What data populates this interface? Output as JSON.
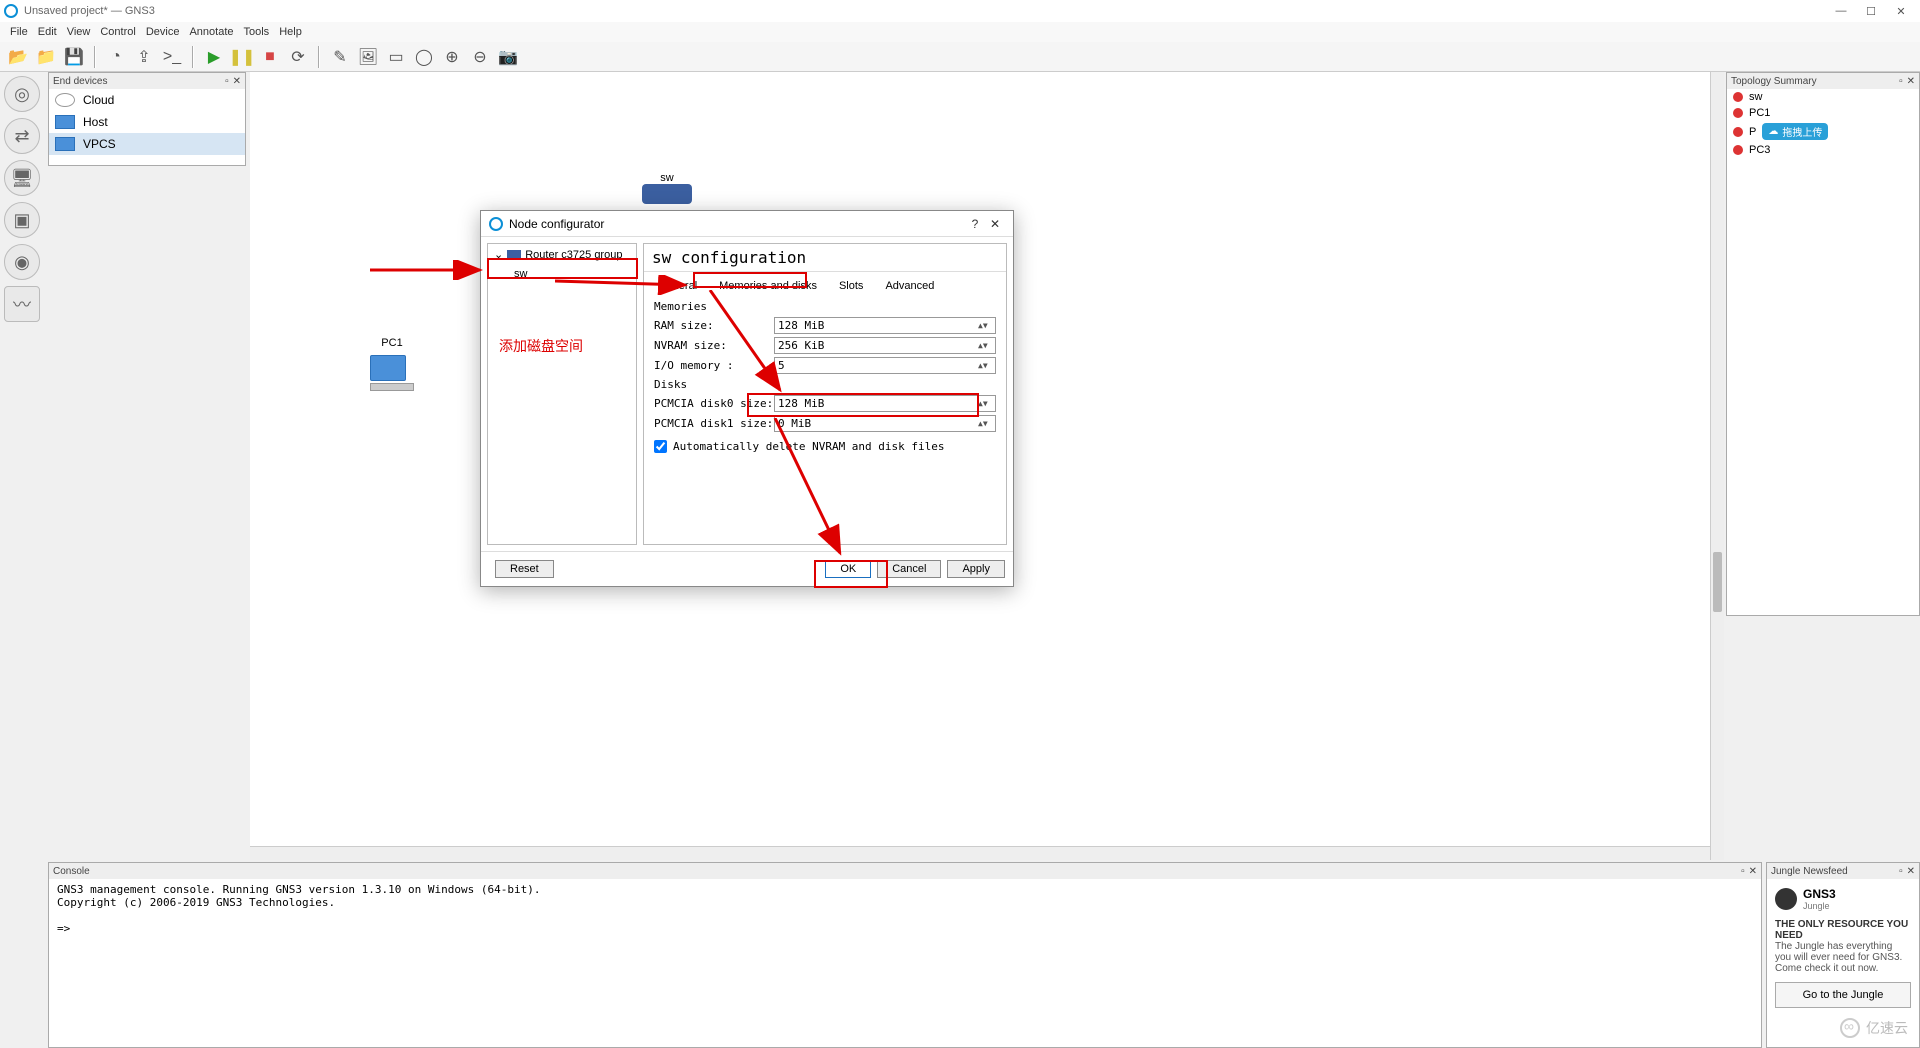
{
  "window": {
    "title": "Unsaved project* — GNS3",
    "controls": {
      "min": "—",
      "max": "☐",
      "close": "✕"
    }
  },
  "menubar": [
    "File",
    "Edit",
    "View",
    "Control",
    "Device",
    "Annotate",
    "Tools",
    "Help"
  ],
  "toolbar_icons": [
    "open-project",
    "open-folder",
    "save",
    "clock",
    "export",
    "console",
    "play",
    "pause",
    "stop",
    "reload",
    "edit-note",
    "image",
    "select-rect",
    "select-ellipse",
    "zoom-in",
    "zoom-out",
    "screenshot"
  ],
  "leftdock": [
    "router-category",
    "switch-category",
    "end-devices-category",
    "security-category",
    "all-devices-category",
    "link-tool"
  ],
  "panels": {
    "end_devices": {
      "title": "End devices",
      "items": [
        "Cloud",
        "Host",
        "VPCS"
      ],
      "selected": 2
    },
    "topology": {
      "title": "Topology Summary",
      "items": [
        "sw",
        "PC1",
        "PC2",
        "PC3"
      ],
      "upload_tag": "拖拽上传"
    },
    "console": {
      "title": "Console",
      "lines": [
        "GNS3 management console. Running GNS3 version 1.3.10 on Windows (64-bit).",
        "Copyright (c) 2006-2019 GNS3 Technologies.",
        "",
        "=>"
      ]
    },
    "jungle": {
      "title": "Jungle Newsfeed",
      "brand1": "GNS3",
      "brand2": "Jungle",
      "headline": "THE ONLY RESOURCE YOU NEED",
      "body": "The Jungle has everything you will ever need for GNS3. Come check it out now.",
      "button": "Go to the Jungle"
    }
  },
  "canvas": {
    "nodes": {
      "sw": {
        "label": "sw",
        "kind": "switch"
      },
      "pc1": {
        "label": "PC1",
        "kind": "pc"
      }
    }
  },
  "dialog": {
    "title": "Node configurator",
    "help": "?",
    "close": "✕",
    "tree": {
      "root": "Router c3725 group",
      "child": "sw"
    },
    "main_title": "sw configuration",
    "tabs": [
      "General",
      "Memories and disks",
      "Slots",
      "Advanced"
    ],
    "active_tab": 1,
    "groups": {
      "memories": {
        "label": "Memories",
        "rows": [
          {
            "label": "RAM size:",
            "value": "128 MiB"
          },
          {
            "label": "NVRAM size:",
            "value": "256 KiB"
          },
          {
            "label": "I/O memory :",
            "value": "5"
          }
        ]
      },
      "disks": {
        "label": "Disks",
        "rows": [
          {
            "label": "PCMCIA disk0 size:",
            "value": "128 MiB"
          },
          {
            "label": "PCMCIA disk1 size:",
            "value": "0 MiB"
          }
        ]
      }
    },
    "checkbox": {
      "checked": true,
      "label": "Automatically delete NVRAM and disk files"
    },
    "buttons": {
      "reset": "Reset",
      "ok": "OK",
      "cancel": "Cancel",
      "apply": "Apply"
    }
  },
  "annotations": {
    "text": "添加磁盘空间"
  },
  "watermark": "亿速云"
}
